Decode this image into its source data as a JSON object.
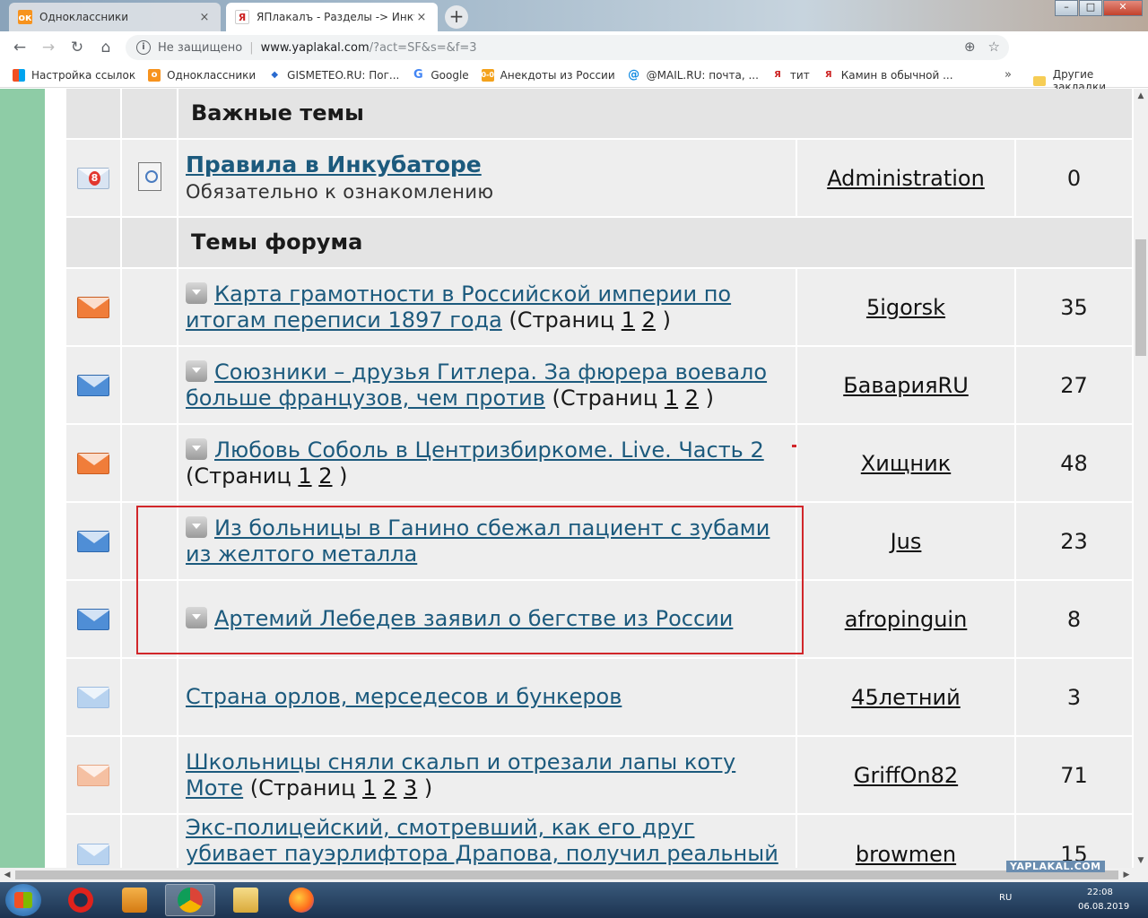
{
  "browser": {
    "tabs": [
      {
        "title": "Одноклассники",
        "close": "×"
      },
      {
        "title": "ЯПлакалъ - Разделы -> Инкубат",
        "close": "×"
      }
    ],
    "new_tab": "+",
    "window_controls": {
      "minimize": "–",
      "maximize": "□",
      "close": "✕"
    },
    "nav": {
      "back": "←",
      "forward": "→",
      "reload": "↻",
      "home": "⌂"
    },
    "address": {
      "security": "Не защищено",
      "host": "www.yaplakal.com",
      "path": "/?act=SF&s=&f=3"
    },
    "bookmarks": [
      {
        "label": "Настройка ссылок",
        "icon": "apps-grid-icon"
      },
      {
        "label": "Одноклассники",
        "icon": "ok-icon"
      },
      {
        "label": "GISMETEO.RU: Пог...",
        "icon": "gismeteo-icon"
      },
      {
        "label": "Google",
        "icon": "google-icon"
      },
      {
        "label": "Анекдоты из России",
        "icon": "anekdot-icon"
      },
      {
        "label": "@MAIL.RU: почта, ...",
        "icon": "mailru-icon"
      },
      {
        "label": "тит",
        "icon": "yaplakal-icon"
      },
      {
        "label": "Камин в обычной ...",
        "icon": "yaplakal-icon"
      }
    ],
    "bookmarks_more": "»",
    "other_bookmarks": "Другие закладки"
  },
  "forum": {
    "sections": {
      "important": "Важные темы",
      "topics": "Темы форума"
    },
    "pinned": {
      "badge": "8",
      "title": "Правила в Инкубаторе",
      "description": "Обязательно к ознакомлению",
      "author": "Administration",
      "replies": "0"
    },
    "pages_label": "(Страниц",
    "pages_close": ")",
    "topics": [
      {
        "title": "Карта грамотности в Российской империи по итогам переписи 1897 года",
        "pages": [
          "1",
          "2"
        ],
        "author": "5igorsk",
        "replies": "35",
        "icon": "orange",
        "prefix": true
      },
      {
        "title": "Союзники – друзья Гитлера. За фюрера воевало больше французов, чем против",
        "pages": [
          "1",
          "2"
        ],
        "author": "БаварияRU",
        "replies": "27",
        "icon": "blue",
        "prefix": true
      },
      {
        "title": "Любовь Соболь в Центризбиркоме. Live. Часть 2",
        "pages": [
          "1",
          "2"
        ],
        "author": "Хищник",
        "replies": "48",
        "icon": "orange",
        "prefix": true
      },
      {
        "title": "Из больницы в Ганино сбежал пациент с зубами из желтого металла",
        "pages": [],
        "author": "Jus",
        "replies": "23",
        "icon": "blue",
        "prefix": true
      },
      {
        "title": "Артемий Лебедев заявил о бегстве из России",
        "pages": [],
        "author": "afropinguin",
        "replies": "8",
        "icon": "blue",
        "prefix": true
      },
      {
        "title": "Страна орлов, мерседесов и бункеров",
        "pages": [],
        "author": "45летний",
        "replies": "3",
        "icon": "lblue",
        "prefix": false
      },
      {
        "title": "Школьницы сняли скальп и отрезали лапы коту Моте",
        "pages": [
          "1",
          "2",
          "3"
        ],
        "author": "GriffOn82",
        "replies": "71",
        "icon": "lorange",
        "prefix": false
      },
      {
        "title": "Экс-полицейский, смотревший, как его друг убивает пауэрлифтора Драпова, получил реальный срок",
        "pages": [],
        "author": "browmen",
        "replies": "15",
        "icon": "lblue",
        "prefix": false
      }
    ]
  },
  "taskbar": {
    "lang": "RU",
    "time": "22:08",
    "date": "06.08.2019",
    "watermark": "YAPLAKAL.COM"
  },
  "colors": {
    "link": "#1c5a7d",
    "green_strip": "#8ecca6",
    "highlight": "#d1262a"
  }
}
